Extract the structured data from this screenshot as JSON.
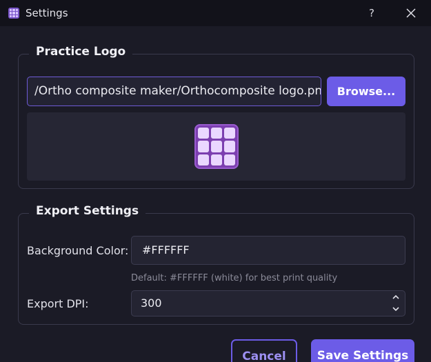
{
  "window": {
    "title": "Settings",
    "help_label": "?",
    "icons": {
      "app": "app-grid-icon",
      "close": "close-icon"
    }
  },
  "practice_logo": {
    "group_title": "Practice Logo",
    "path_value": "/Ortho composite maker/Orthocomposite logo.png",
    "browse_label": "Browse...",
    "preview_icon": "logo-grid-icon"
  },
  "export_settings": {
    "group_title": "Export Settings",
    "background_color_label": "Background Color:",
    "background_color_value": "#FFFFFF",
    "background_color_hint": "Default: #FFFFFF (white) for best print quality",
    "dpi_label": "Export DPI:",
    "dpi_value": "300"
  },
  "actions": {
    "cancel_label": "Cancel",
    "save_label": "Save Settings"
  },
  "colors": {
    "accent": "#6c5ce7",
    "background": "#1b1b26",
    "titlebar": "#12121a"
  }
}
